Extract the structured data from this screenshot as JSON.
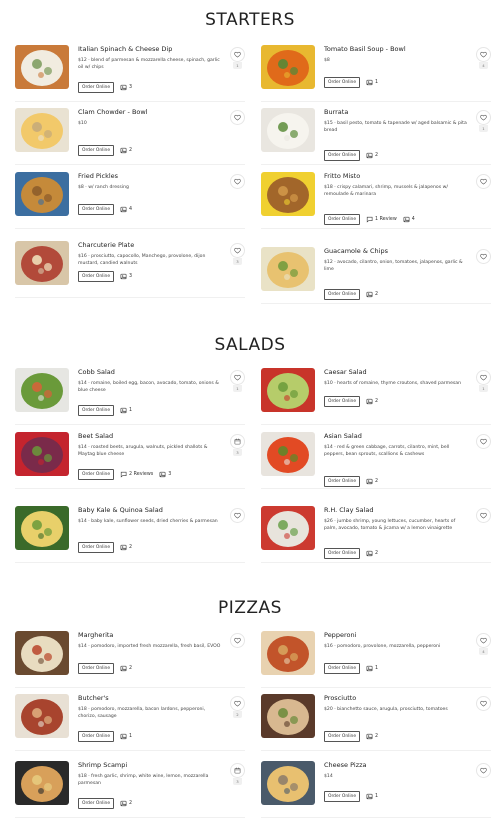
{
  "sections": [
    {
      "title": "STARTERS",
      "items": [
        {
          "name": "Italian Spinach & Cheese Dip",
          "desc": "$12 · blend of parmesan & mozzarella cheese, spinach, garlic oil w/ chips",
          "order": "Order Online",
          "photos": "3",
          "count": "1",
          "photo": "dip"
        },
        {
          "name": "Tomato Basil Soup - Bowl",
          "desc": "$8",
          "order": "Order Online",
          "photos": "1",
          "count": "4",
          "photo": "soup"
        },
        {
          "name": "Clam Chowder - Bowl",
          "desc": "$10",
          "order": "Order Online",
          "photos": "2",
          "count": "",
          "photo": "chowder"
        },
        {
          "name": "Burrata",
          "desc": "$15 · basil pesto, tomato & tapenade w/ aged balsamic & pita bread",
          "order": "Order Online",
          "photos": "2",
          "count": "1",
          "photo": "burrata"
        },
        {
          "name": "Fried Pickles",
          "desc": "$8 · w/ ranch dressing",
          "order": "Order Online",
          "photos": "4",
          "count": "",
          "photo": "pickles"
        },
        {
          "name": "Fritto Misto",
          "desc": "$18 · crispy calamari, shrimp, mussels & jalapenos w/ remoulade & marinara",
          "order": "Order Online",
          "reviews": "1 Review",
          "photos": "4",
          "count": "",
          "photo": "fritto"
        },
        {
          "name": "Charcuterie Plate",
          "desc": "$16 · prosciutto, capocollo, Manchego, provolone, dijon mustard, candied walnuts",
          "order": "Order Online",
          "photos": "3",
          "count": "3",
          "photo": "charcuterie"
        },
        {
          "name": "Guacamole & Chips",
          "desc": "$12 · avocado, cilantro, onion, tomatoes, jalapenos, garlic & lime",
          "order": "Order Online",
          "photos": "2",
          "count": "",
          "photo": "guac"
        }
      ]
    },
    {
      "title": "SALADS",
      "items": [
        {
          "name": "Cobb Salad",
          "desc": "$14 · romaine, boiled egg, bacon, avocado, tomato, onions & blue cheese",
          "order": "Order Online",
          "photos": "1",
          "count": "1",
          "photo": "cobb"
        },
        {
          "name": "Caesar Salad",
          "desc": "$10 · hearts of romaine, thyme croutons, shaved parmesan",
          "order": "Order Online",
          "photos": "2",
          "count": "1",
          "photo": "caesar"
        },
        {
          "name": "Beet Salad",
          "desc": "$14 · roasted beets, arugula, walnuts, pickled shallots & Maytag blue cheese",
          "order": "Order Online",
          "reviews": "2 Reviews",
          "photos": "3",
          "count": "3",
          "photo": "beet"
        },
        {
          "name": "Asian Salad",
          "desc": "$14 · red & green cabbage, carrots, cilantro, mint, bell peppers, bean sprouts, scallions & cashews",
          "order": "Order Online",
          "photos": "2",
          "count": "",
          "photo": "asian"
        },
        {
          "name": "Baby Kale & Quinoa Salad",
          "desc": "$14 · baby kale, sunflower seeds, dried cherries & parmesan",
          "order": "Order Online",
          "photos": "2",
          "count": "",
          "photo": "kale"
        },
        {
          "name": "R.H. Clay Salad",
          "desc": "$26 · jumbo shrimp, young lettuces, cucumber, hearts of palm, avocado, tomato & jicama w/ a lemon vinaigrette",
          "order": "Order Online",
          "photos": "2",
          "count": "",
          "photo": "clay"
        }
      ]
    },
    {
      "title": "PIZZAS",
      "items": [
        {
          "name": "Margherita",
          "desc": "$14 · pomodoro, imported fresh mozzarella, fresh basil, EVOO",
          "order": "Order Online",
          "photos": "2",
          "count": "",
          "photo": "margherita"
        },
        {
          "name": "Pepperoni",
          "desc": "$16 · pomodoro, provolone, mozzarella, pepperoni",
          "order": "Order Online",
          "photos": "1",
          "count": "4",
          "photo": "pepperoni"
        },
        {
          "name": "Butcher's",
          "desc": "$18 · pomodoro, mozzarella, bacon lardons, pepperoni, chorizo, sausage",
          "order": "Order Online",
          "photos": "1",
          "count": "2",
          "photo": "butcher"
        },
        {
          "name": "Prosciutto",
          "desc": "$20 · bianchetto sauce, arugula, prosciutto, tomatoes",
          "order": "Order Online",
          "photos": "2",
          "count": "",
          "photo": "prosciutto"
        },
        {
          "name": "Shrimp Scampi",
          "desc": "$18 · fresh garlic, shrimp, white wine, lemon, mozzarella parmesan",
          "order": "Order Online",
          "photos": "2",
          "count": "3",
          "photo": "scampi"
        },
        {
          "name": "Cheese Pizza",
          "desc": "$14",
          "order": "Order Online",
          "photos": "1",
          "count": "",
          "photo": "cheese"
        }
      ]
    }
  ]
}
